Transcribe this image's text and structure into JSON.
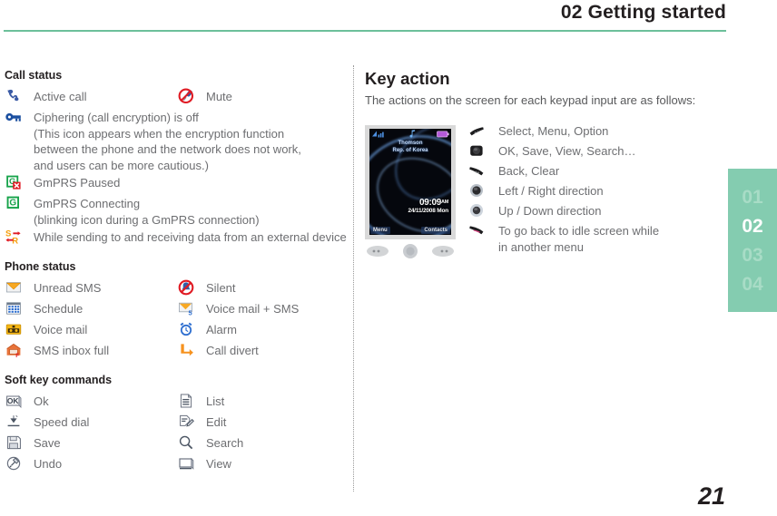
{
  "header": {
    "title": "02 Getting started",
    "rule_color": "#6cc09a"
  },
  "tabs": {
    "items": [
      {
        "label": "01",
        "active": false
      },
      {
        "label": "02",
        "active": true
      },
      {
        "label": "03",
        "active": false
      },
      {
        "label": "04",
        "active": false
      }
    ],
    "background_color": "#84ccb0",
    "active_color": "#ffffff",
    "inactive_color": "#a8dcc6"
  },
  "left_column": {
    "call_status": {
      "title": "Call status",
      "rows": [
        {
          "left": {
            "icon": "phone-handset-icon",
            "label": "Active call"
          },
          "right": {
            "icon": "mute-microphone-icon",
            "label": "Mute"
          }
        },
        {
          "left": {
            "icon": "key-icon",
            "label": "Ciphering (call encryption) is off\n(This icon appears when the encryption function\nbetween the phone and the network does not work,\nand users can be more cautious.)"
          },
          "right": null
        },
        {
          "left": {
            "icon": "gprs-paused-icon",
            "label": "GmPRS Paused"
          },
          "right": null
        },
        {
          "left": {
            "icon": "gprs-connecting-icon",
            "label": "GmPRS Connecting\n(blinking icon during a GmPRS connection)"
          },
          "right": null
        },
        {
          "left": {
            "icon": "data-transfer-icon",
            "label": "While sending to and receiving data from an external device"
          },
          "right": null
        }
      ]
    },
    "phone_status": {
      "title": "Phone status",
      "rows": [
        {
          "left": {
            "icon": "unread-sms-icon",
            "label": "Unread SMS"
          },
          "right": {
            "icon": "silent-mode-icon",
            "label": "Silent"
          }
        },
        {
          "left": {
            "icon": "schedule-calendar-icon",
            "label": "Schedule"
          },
          "right": {
            "icon": "voicemail-sms-icon",
            "label": "Voice mail + SMS"
          }
        },
        {
          "left": {
            "icon": "voicemail-icon",
            "label": "Voice mail"
          },
          "right": {
            "icon": "alarm-clock-icon",
            "label": "Alarm"
          }
        },
        {
          "left": {
            "icon": "sms-inbox-full-icon",
            "label": "SMS inbox full"
          },
          "right": {
            "icon": "call-divert-icon",
            "label": "Call divert"
          }
        }
      ]
    },
    "soft_key_commands": {
      "title": "Soft key commands",
      "rows": [
        {
          "left": {
            "icon": "ok-key-icon",
            "label": "Ok"
          },
          "right": {
            "icon": "list-icon",
            "label": "List"
          }
        },
        {
          "left": {
            "icon": "speed-dial-icon",
            "label": "Speed dial"
          },
          "right": {
            "icon": "edit-pencil-icon",
            "label": "Edit"
          }
        },
        {
          "left": {
            "icon": "save-floppy-icon",
            "label": "Save"
          },
          "right": {
            "icon": "search-magnifier-icon",
            "label": "Search"
          }
        },
        {
          "left": {
            "icon": "undo-icon",
            "label": "Undo"
          },
          "right": {
            "icon": "view-monitor-icon",
            "label": "View"
          }
        }
      ]
    }
  },
  "right_column": {
    "title": "Key action",
    "intro": "The actions on the screen for each keypad input are as follows:",
    "phone_screenshot": {
      "carrier_line1": "Thomson",
      "carrier_line2": "Rep. of Korea",
      "time": "09:09",
      "time_ampm": "AM",
      "date": "24/11/2008  Mon",
      "softkey_left": "Menu",
      "softkey_right": "Contacts"
    },
    "key_actions": [
      {
        "icon": "left-softkey-icon",
        "label": "Select, Menu, Option"
      },
      {
        "icon": "center-ok-key-icon",
        "label": "OK, Save, View, Search…"
      },
      {
        "icon": "right-softkey-icon",
        "label": "Back, Clear"
      },
      {
        "icon": "left-right-nav-icon",
        "label": "Left / Right direction"
      },
      {
        "icon": "up-down-nav-icon",
        "label": "Up / Down direction"
      },
      {
        "icon": "end-call-key-icon",
        "label": "To go back to idle screen while\nin another menu"
      }
    ]
  },
  "footer": {
    "page_number": "21"
  }
}
